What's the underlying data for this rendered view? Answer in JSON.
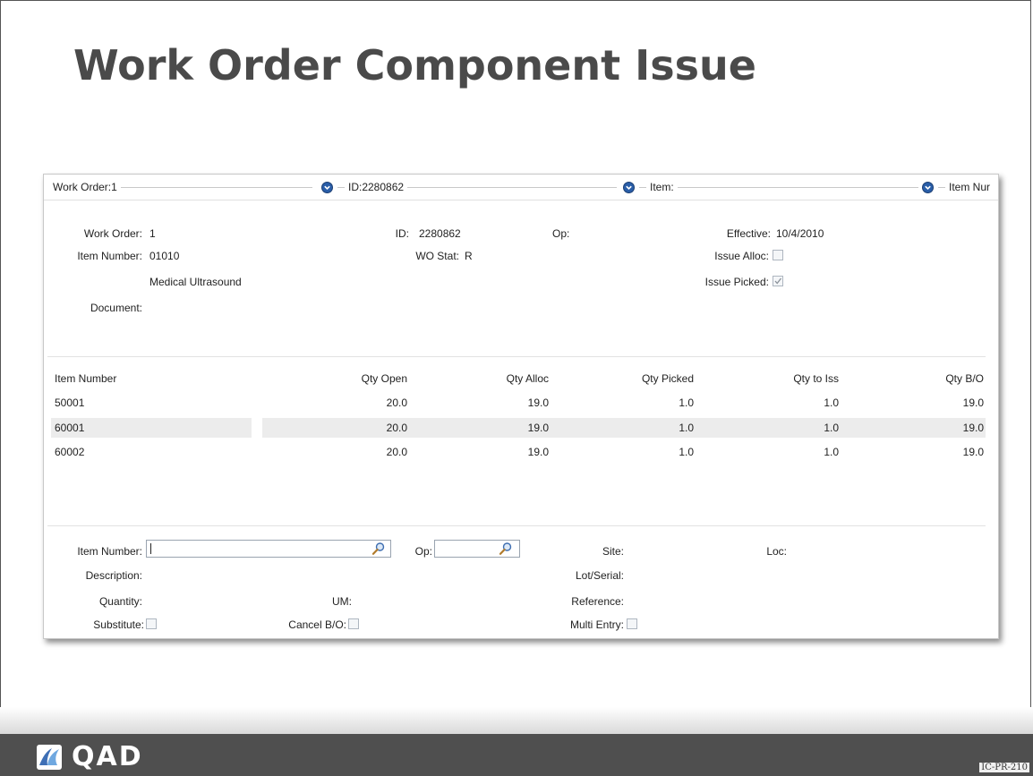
{
  "slide": {
    "title": "Work Order Component Issue",
    "brand": "QAD",
    "code": "IC-PR-210"
  },
  "topbar": {
    "work_order_label": "Work Order:1",
    "id_label": "ID:2280862",
    "item_label": "Item:",
    "item_num_label": "Item Nur"
  },
  "header": {
    "work_order_label": "Work Order:",
    "work_order_value": "1",
    "id_label": "ID:",
    "id_value": "2280862",
    "op_label": "Op:",
    "effective_label": "Effective:",
    "effective_value": "10/4/2010",
    "item_number_label": "Item Number:",
    "item_number_value": "01010",
    "wo_stat_label": "WO Stat:",
    "wo_stat_value": "R",
    "issue_alloc_label": "Issue Alloc:",
    "issue_alloc_checked": false,
    "description_value": "Medical Ultrasound",
    "issue_picked_label": "Issue Picked:",
    "issue_picked_checked": true,
    "document_label": "Document:"
  },
  "grid": {
    "columns": [
      "Item Number",
      "Qty Open",
      "Qty Alloc",
      "Qty Picked",
      "Qty to Iss",
      "Qty B/O"
    ],
    "rows": [
      [
        "50001",
        "20.0",
        "19.0",
        "1.0",
        "1.0",
        "19.0"
      ],
      [
        "60001",
        "20.0",
        "19.0",
        "1.0",
        "1.0",
        "19.0"
      ],
      [
        "60002",
        "20.0",
        "19.0",
        "1.0",
        "1.0",
        "19.0"
      ]
    ]
  },
  "entry": {
    "item_number_label": "Item Number:",
    "item_number_value": "",
    "op_label": "Op:",
    "op_value": "",
    "site_label": "Site:",
    "loc_label": "Loc:",
    "description_label": "Description:",
    "lot_serial_label": "Lot/Serial:",
    "quantity_label": "Quantity:",
    "um_label": "UM:",
    "reference_label": "Reference:",
    "substitute_label": "Substitute:",
    "cancel_bo_label": "Cancel B/O:",
    "multi_entry_label": "Multi Entry:"
  },
  "colors": {
    "dropdown_blue": "#2a5ea8",
    "footer_gray": "#4f4f4f",
    "title_gray": "#4a4a4a",
    "row_highlight": "#ececec"
  }
}
